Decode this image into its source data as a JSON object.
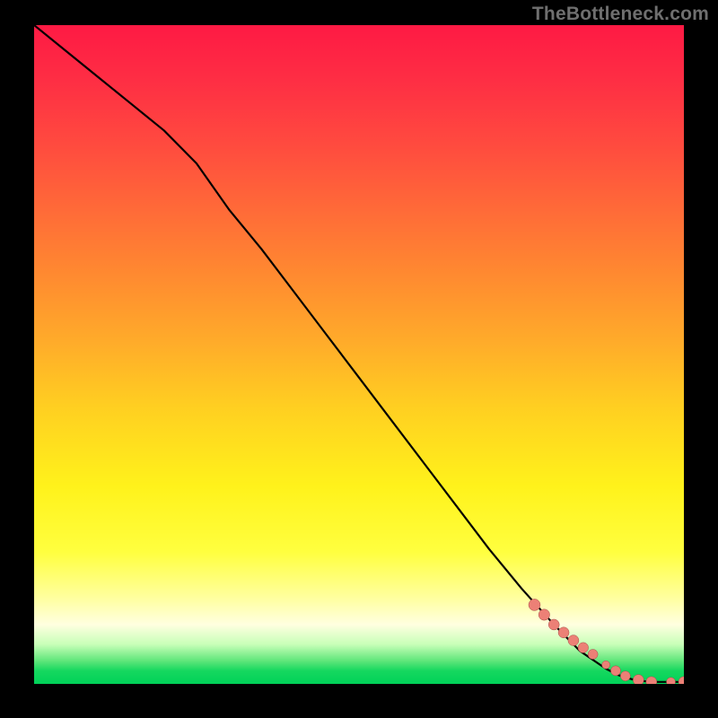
{
  "watermark": "TheBottleneck.com",
  "chart_data": {
    "type": "line",
    "title": "",
    "xlabel": "",
    "ylabel": "",
    "xlim": [
      0,
      100
    ],
    "ylim": [
      0,
      100
    ],
    "series": [
      {
        "name": "curve",
        "x": [
          0,
          5,
          10,
          15,
          20,
          25,
          30,
          35,
          40,
          45,
          50,
          55,
          60,
          65,
          70,
          75,
          80,
          84,
          88,
          90,
          92,
          94,
          96,
          98,
          100
        ],
        "values": [
          100,
          96,
          92,
          88,
          84,
          79,
          72,
          66,
          59.5,
          53,
          46.5,
          40,
          33.5,
          27,
          20.5,
          14.5,
          9,
          5,
          2.3,
          1.3,
          0.7,
          0.4,
          0.3,
          0.3,
          0.3
        ]
      }
    ],
    "markers": {
      "name": "dots",
      "x": [
        77,
        78.5,
        80,
        81.5,
        83,
        84.5,
        86,
        88,
        89.5,
        91,
        93,
        95,
        98,
        100
      ],
      "values": [
        12,
        10.5,
        9,
        7.8,
        6.6,
        5.5,
        4.5,
        2.9,
        2.0,
        1.2,
        0.6,
        0.3,
        0.3,
        0.3
      ],
      "radius": [
        6.5,
        6.2,
        6.0,
        6.0,
        6.0,
        5.8,
        5.5,
        4.5,
        5.5,
        5.5,
        6.0,
        6.0,
        5.0,
        6.0
      ]
    }
  },
  "colors": {
    "marker_fill": "#ec8076",
    "marker_stroke": "#a54f48",
    "line": "#000000"
  }
}
